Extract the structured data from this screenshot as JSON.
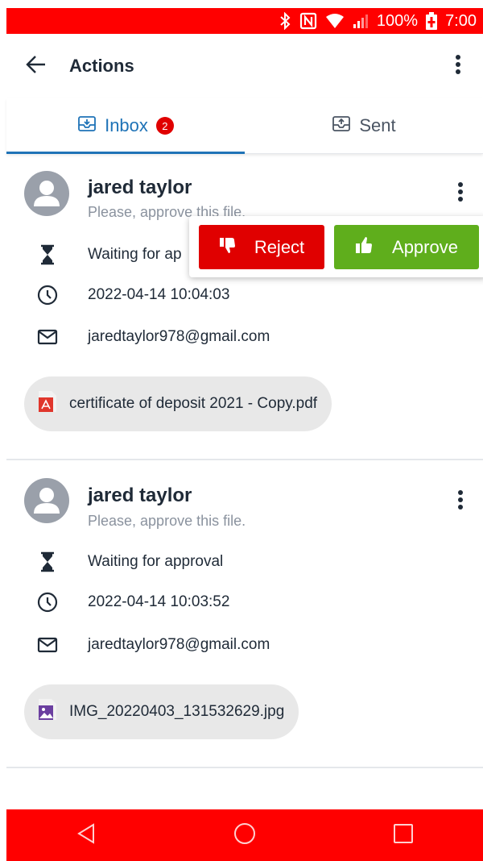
{
  "status_bar": {
    "bluetooth_icon": "bluetooth-icon",
    "nfc_icon": "nfc-icon",
    "wifi_icon": "wifi-icon",
    "signal_icon": "signal-icon",
    "battery_percent": "100%",
    "battery_icon": "battery-charging-icon",
    "time": "7:00",
    "background_color": "#ff0000"
  },
  "app_bar": {
    "back_icon": "arrow-left-icon",
    "title": "Actions",
    "menu_icon": "more-vertical-icon"
  },
  "tabs": [
    {
      "label": "Inbox",
      "icon": "inbox-icon",
      "badge": "2",
      "active": true
    },
    {
      "label": "Sent",
      "icon": "outbox-icon",
      "active": false
    }
  ],
  "colors": {
    "accent": "#1f73b7",
    "reject": "#e00000",
    "approve": "#5fae1c",
    "badge": "#e00000",
    "system_bars": "#ff0000"
  },
  "items": [
    {
      "sender_name": "jared taylor",
      "message": "Please, approve this file.",
      "status": "Waiting for approval",
      "status_visible": "Waiting for ap",
      "datetime": "2022-04-14 10:04:03",
      "email": "jaredtaylor978@gmail.com",
      "attachment": {
        "name": "certificate of deposit 2021 - Copy.pdf",
        "icon": "pdf-file-icon"
      }
    },
    {
      "sender_name": "jared taylor",
      "message": "Please, approve this file.",
      "status": "Waiting for approval",
      "datetime": "2022-04-14 10:03:52",
      "email": "jaredtaylor978@gmail.com",
      "attachment": {
        "name": "IMG_20220403_131532629.jpg",
        "icon": "image-file-icon"
      }
    }
  ],
  "action_popover": {
    "reject_label": "Reject",
    "reject_icon": "thumbs-down-icon",
    "approve_label": "Approve",
    "approve_icon": "thumbs-up-icon"
  },
  "nav_bar": {
    "back_icon": "nav-back-triangle-icon",
    "home_icon": "nav-home-circle-icon",
    "recents_icon": "nav-recents-square-icon"
  }
}
